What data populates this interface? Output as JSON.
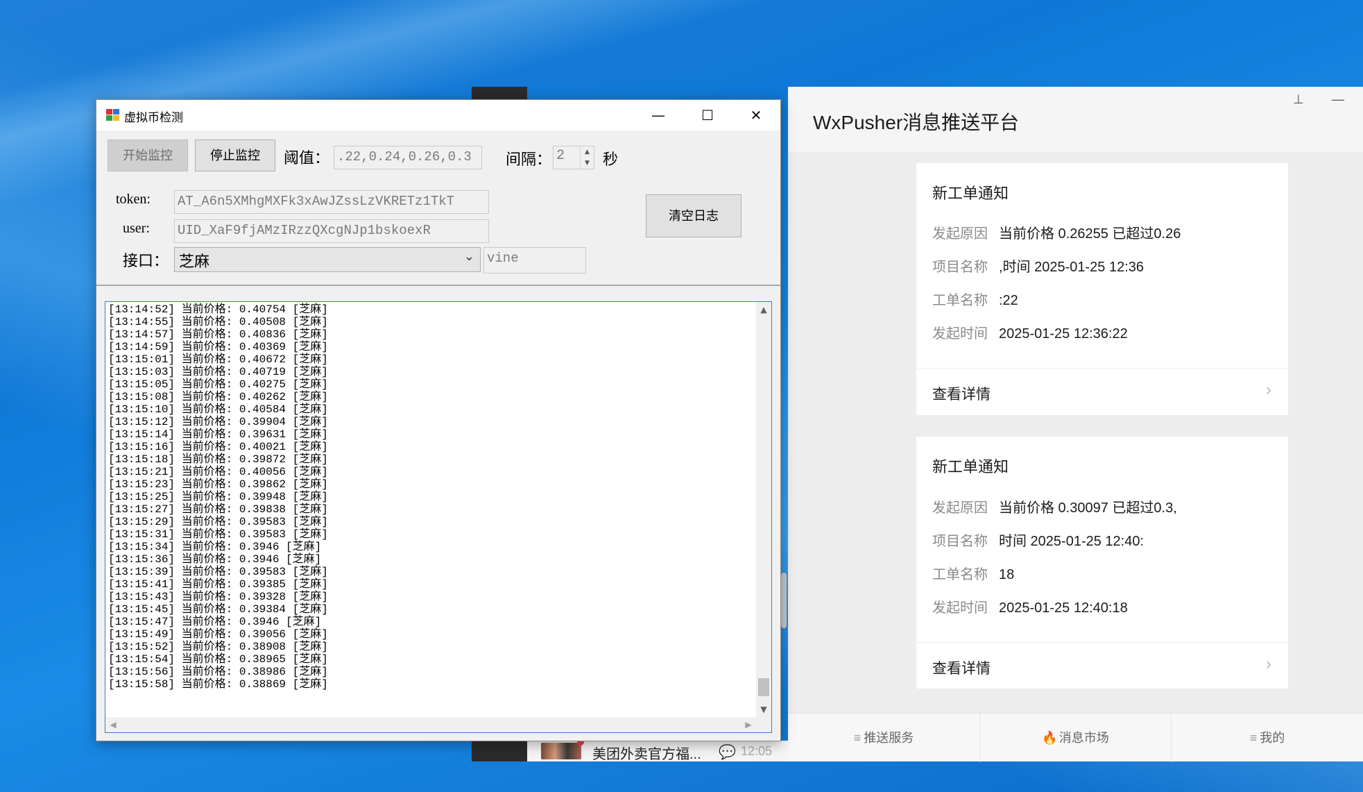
{
  "app": {
    "title": "虚拟币检测",
    "controls": {
      "minimize": "—",
      "maximize": "☐",
      "close": "✕"
    },
    "start_button": "开始监控",
    "stop_button": "停止监控",
    "threshold_label": "阈值：",
    "threshold_value": ".22,0.24,0.26,0.3",
    "interval_label": "间隔：",
    "interval_value": "2",
    "interval_unit": "秒",
    "token_label": "token:",
    "token_value": "AT_A6n5XMhgMXFk3xAwJZssLzVKRETz1TkT",
    "user_label": "user:",
    "user_value": "UID_XaF9fjAMzIRzzQXcgNJp1bskoexR",
    "api_label": "接口：",
    "api_selected": "芝麻",
    "api_extra": "vine",
    "clear_button": "清空日志",
    "log_lines": [
      "[13:14:52] 当前价格: 0.40754 [芝麻]",
      "[13:14:55] 当前价格: 0.40508 [芝麻]",
      "[13:14:57] 当前价格: 0.40836 [芝麻]",
      "[13:14:59] 当前价格: 0.40369 [芝麻]",
      "[13:15:01] 当前价格: 0.40672 [芝麻]",
      "[13:15:03] 当前价格: 0.40719 [芝麻]",
      "[13:15:05] 当前价格: 0.40275 [芝麻]",
      "[13:15:08] 当前价格: 0.40262 [芝麻]",
      "[13:15:10] 当前价格: 0.40584 [芝麻]",
      "[13:15:12] 当前价格: 0.39904 [芝麻]",
      "[13:15:14] 当前价格: 0.39631 [芝麻]",
      "[13:15:16] 当前价格: 0.40021 [芝麻]",
      "[13:15:18] 当前价格: 0.39872 [芝麻]",
      "[13:15:21] 当前价格: 0.40056 [芝麻]",
      "[13:15:23] 当前价格: 0.39862 [芝麻]",
      "[13:15:25] 当前价格: 0.39948 [芝麻]",
      "[13:15:27] 当前价格: 0.39838 [芝麻]",
      "[13:15:29] 当前价格: 0.39583 [芝麻]",
      "[13:15:31] 当前价格: 0.39583 [芝麻]",
      "[13:15:34] 当前价格: 0.3946 [芝麻]",
      "[13:15:36] 当前价格: 0.3946 [芝麻]",
      "[13:15:39] 当前价格: 0.39583 [芝麻]",
      "[13:15:41] 当前价格: 0.39385 [芝麻]",
      "[13:15:43] 当前价格: 0.39328 [芝麻]",
      "[13:15:45] 当前价格: 0.39384 [芝麻]",
      "[13:15:47] 当前价格: 0.3946 [芝麻]",
      "[13:15:49] 当前价格: 0.39056 [芝麻]",
      "[13:15:52] 当前价格: 0.38908 [芝麻]",
      "[13:15:54] 当前价格: 0.38965 [芝麻]",
      "[13:15:56] 当前价格: 0.38986 [芝麻]",
      "[13:15:58] 当前价格: 0.38869 [芝麻]"
    ]
  },
  "wxpusher": {
    "title": "WxPusher消息推送平台",
    "controls": {
      "pin": "⊥",
      "minimize": "—"
    },
    "cards": [
      {
        "title": "新工单通知",
        "rows": [
          {
            "k": "发起原因",
            "v": "当前价格 0.26255 已超过0.26"
          },
          {
            "k": "项目名称",
            "v": ",时间 2025-01-25 12:36"
          },
          {
            "k": "工单名称",
            "v": ":22"
          },
          {
            "k": "发起时间",
            "v": "2025-01-25 12:36:22"
          }
        ],
        "link": "查看详情"
      },
      {
        "title": "新工单通知",
        "rows": [
          {
            "k": "发起原因",
            "v": "当前价格 0.30097 已超过0.3,"
          },
          {
            "k": "项目名称",
            "v": "时间 2025-01-25 12:40:"
          },
          {
            "k": "工单名称",
            "v": "18"
          },
          {
            "k": "发起时间",
            "v": "2025-01-25 12:40:18"
          }
        ],
        "link": "查看详情"
      }
    ],
    "tabs": [
      "推送服务",
      "消息市场",
      "我的"
    ]
  },
  "background_chat": {
    "title": "美团外卖官方福...",
    "time": "12:05"
  },
  "colors": {
    "desktop": "#0f78d6",
    "log_border": "#2d7fd0",
    "fire_icon": "#f07020"
  }
}
